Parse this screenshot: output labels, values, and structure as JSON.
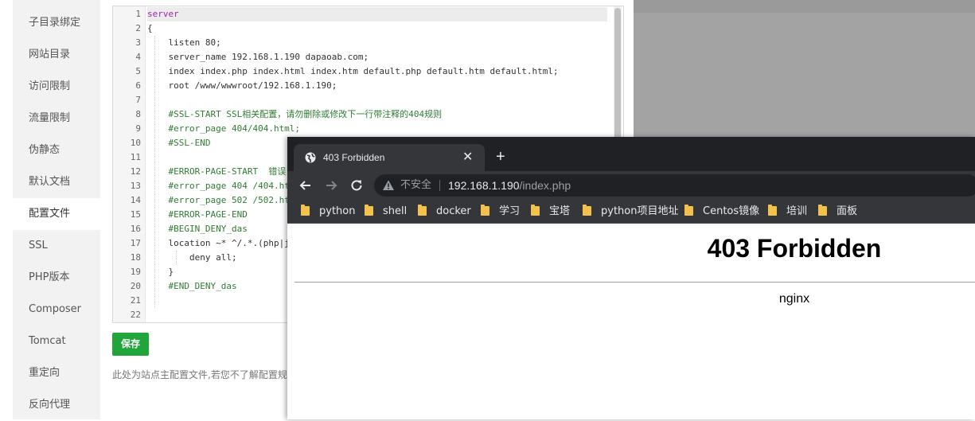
{
  "sidebar": {
    "items": [
      {
        "label": "子目录绑定",
        "active": false
      },
      {
        "label": "网站目录",
        "active": false
      },
      {
        "label": "访问限制",
        "active": false
      },
      {
        "label": "流量限制",
        "active": false
      },
      {
        "label": "伪静态",
        "active": false
      },
      {
        "label": "默认文档",
        "active": false
      },
      {
        "label": "配置文件",
        "active": true
      },
      {
        "label": "SSL",
        "active": false
      },
      {
        "label": "PHP版本",
        "active": false
      },
      {
        "label": "Composer",
        "active": false
      },
      {
        "label": "Tomcat",
        "active": false
      },
      {
        "label": "重定向",
        "active": false
      },
      {
        "label": "反向代理",
        "active": false
      }
    ]
  },
  "editor": {
    "lines": [
      "server",
      "{",
      "    listen 80;",
      "    server_name 192.168.1.190 dapaoab.com;",
      "    index index.php index.html index.htm default.php default.htm default.html;",
      "    root /www/wwwroot/192.168.1.190;",
      "",
      "    #SSL-START SSL相关配置，请勿删除或修改下一行带注释的404规则",
      "    #error_page 404/404.html;",
      "    #SSL-END",
      "",
      "    #ERROR-PAGE-START  错误",
      "    #error_page 404 /404.ht",
      "    #error_page 502 /502.ht",
      "    #ERROR-PAGE-END",
      "    #BEGIN_DENY_das",
      "    location ~* ^/.*.(php|j",
      "        deny all;",
      "    }",
      "    #END_DENY_das",
      "",
      ""
    ]
  },
  "save_button": {
    "label": "保存"
  },
  "note": "此处为站点主配置文件,若您不了解配置规",
  "browser": {
    "tab_title": "403 Forbidden",
    "tab_close": "✕",
    "new_tab": "+",
    "insecure_label": "不安全",
    "url_host": "192.168.1.190",
    "url_path": "/index.php",
    "bookmarks": [
      "python",
      "shell",
      "docker",
      "学习",
      "宝塔",
      "python项目地址",
      "Centos镜像",
      "培训",
      "面板"
    ],
    "page_heading": "403 Forbidden",
    "page_footer": "nginx"
  },
  "icons": {
    "back": "arrow-left-icon",
    "forward": "arrow-right-icon",
    "reload": "reload-icon",
    "warning": "warning-icon",
    "globe": "globe-icon",
    "folder": "folder-icon"
  },
  "colors": {
    "save_green": "#20a53a",
    "keyword": "#9c27b0",
    "comment": "#2e7d32",
    "chrome_dark": "#202124",
    "chrome_tab": "#35363a",
    "folder_yellow": "#f3c24b"
  }
}
